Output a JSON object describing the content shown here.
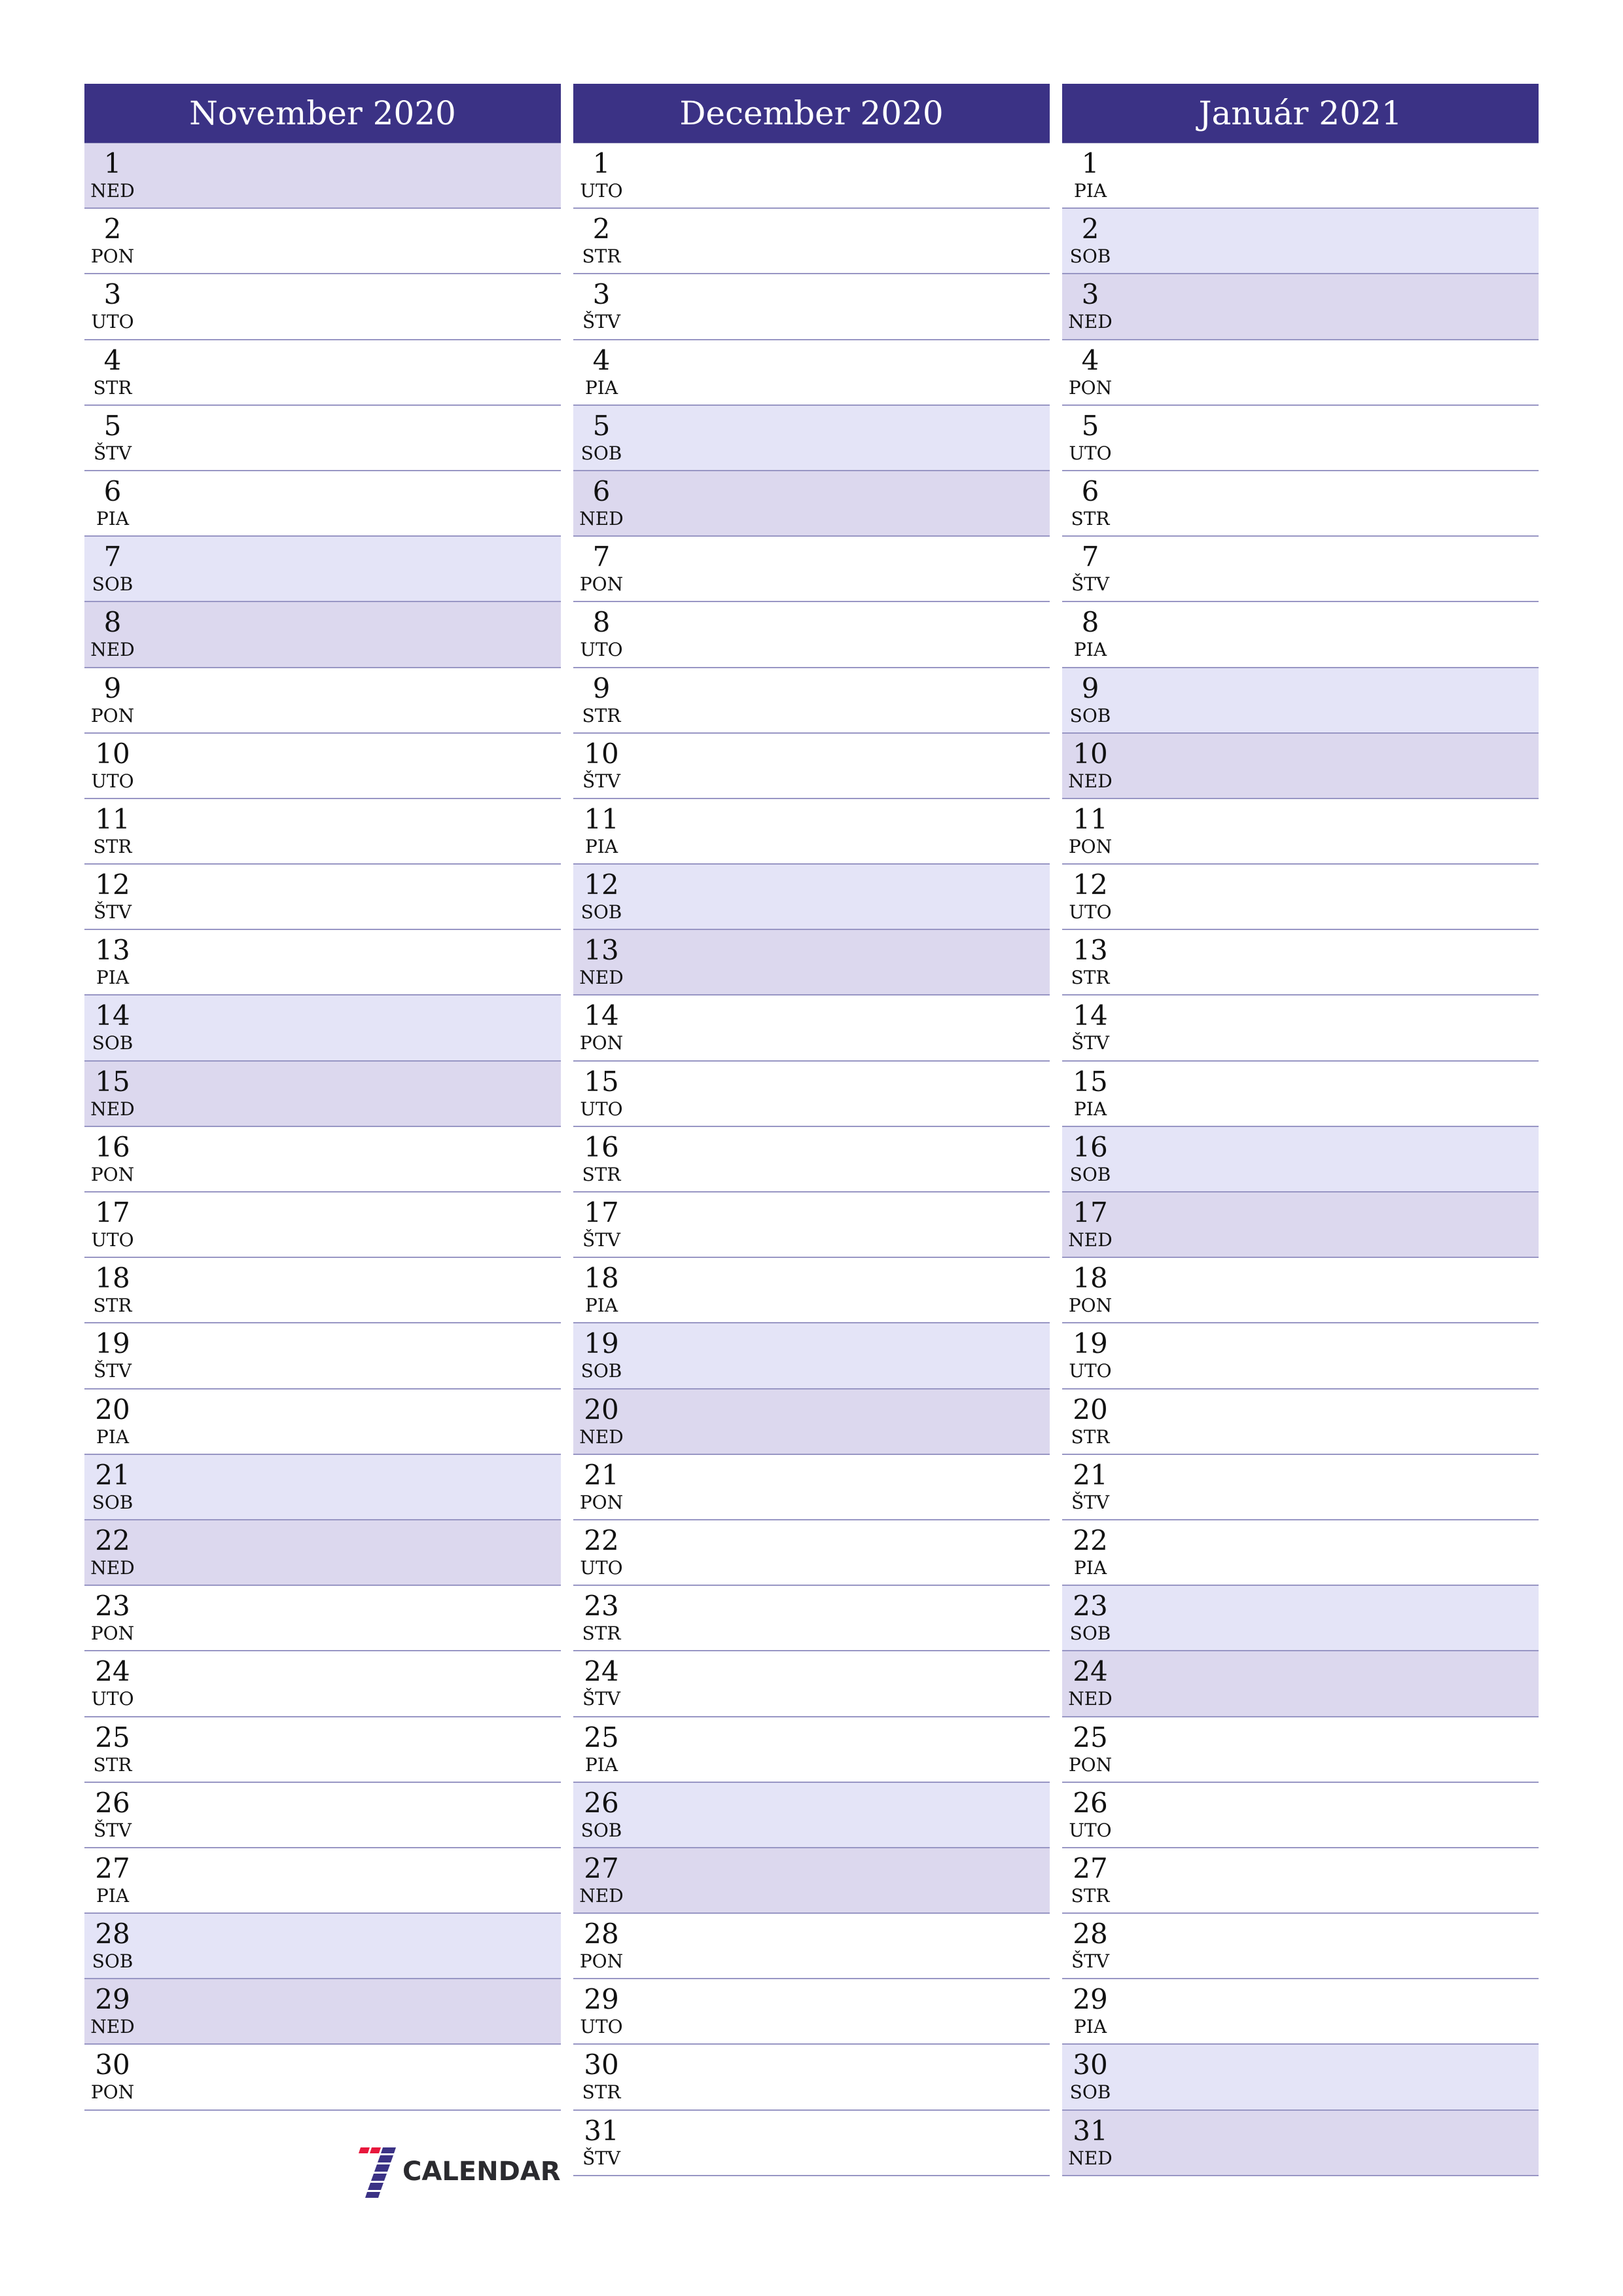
{
  "colors": {
    "header_bg": "#3b3285",
    "header_text": "#ffffff",
    "saturday_bg": "#e4e4f7",
    "sunday_bg": "#dcd8ee",
    "row_line": "#9896c4",
    "logo_red": "#e8173c",
    "logo_blue": "#3b3285"
  },
  "months": [
    {
      "title": "November 2020",
      "days": [
        {
          "n": "1",
          "d": "NED"
        },
        {
          "n": "2",
          "d": "PON"
        },
        {
          "n": "3",
          "d": "UTO"
        },
        {
          "n": "4",
          "d": "STR"
        },
        {
          "n": "5",
          "d": "ŠTV"
        },
        {
          "n": "6",
          "d": "PIA"
        },
        {
          "n": "7",
          "d": "SOB"
        },
        {
          "n": "8",
          "d": "NED"
        },
        {
          "n": "9",
          "d": "PON"
        },
        {
          "n": "10",
          "d": "UTO"
        },
        {
          "n": "11",
          "d": "STR"
        },
        {
          "n": "12",
          "d": "ŠTV"
        },
        {
          "n": "13",
          "d": "PIA"
        },
        {
          "n": "14",
          "d": "SOB"
        },
        {
          "n": "15",
          "d": "NED"
        },
        {
          "n": "16",
          "d": "PON"
        },
        {
          "n": "17",
          "d": "UTO"
        },
        {
          "n": "18",
          "d": "STR"
        },
        {
          "n": "19",
          "d": "ŠTV"
        },
        {
          "n": "20",
          "d": "PIA"
        },
        {
          "n": "21",
          "d": "SOB"
        },
        {
          "n": "22",
          "d": "NED"
        },
        {
          "n": "23",
          "d": "PON"
        },
        {
          "n": "24",
          "d": "UTO"
        },
        {
          "n": "25",
          "d": "STR"
        },
        {
          "n": "26",
          "d": "ŠTV"
        },
        {
          "n": "27",
          "d": "PIA"
        },
        {
          "n": "28",
          "d": "SOB"
        },
        {
          "n": "29",
          "d": "NED"
        },
        {
          "n": "30",
          "d": "PON"
        }
      ]
    },
    {
      "title": "December 2020",
      "days": [
        {
          "n": "1",
          "d": "UTO"
        },
        {
          "n": "2",
          "d": "STR"
        },
        {
          "n": "3",
          "d": "ŠTV"
        },
        {
          "n": "4",
          "d": "PIA"
        },
        {
          "n": "5",
          "d": "SOB"
        },
        {
          "n": "6",
          "d": "NED"
        },
        {
          "n": "7",
          "d": "PON"
        },
        {
          "n": "8",
          "d": "UTO"
        },
        {
          "n": "9",
          "d": "STR"
        },
        {
          "n": "10",
          "d": "ŠTV"
        },
        {
          "n": "11",
          "d": "PIA"
        },
        {
          "n": "12",
          "d": "SOB"
        },
        {
          "n": "13",
          "d": "NED"
        },
        {
          "n": "14",
          "d": "PON"
        },
        {
          "n": "15",
          "d": "UTO"
        },
        {
          "n": "16",
          "d": "STR"
        },
        {
          "n": "17",
          "d": "ŠTV"
        },
        {
          "n": "18",
          "d": "PIA"
        },
        {
          "n": "19",
          "d": "SOB"
        },
        {
          "n": "20",
          "d": "NED"
        },
        {
          "n": "21",
          "d": "PON"
        },
        {
          "n": "22",
          "d": "UTO"
        },
        {
          "n": "23",
          "d": "STR"
        },
        {
          "n": "24",
          "d": "ŠTV"
        },
        {
          "n": "25",
          "d": "PIA"
        },
        {
          "n": "26",
          "d": "SOB"
        },
        {
          "n": "27",
          "d": "NED"
        },
        {
          "n": "28",
          "d": "PON"
        },
        {
          "n": "29",
          "d": "UTO"
        },
        {
          "n": "30",
          "d": "STR"
        },
        {
          "n": "31",
          "d": "ŠTV"
        }
      ]
    },
    {
      "title": "Január 2021",
      "days": [
        {
          "n": "1",
          "d": "PIA"
        },
        {
          "n": "2",
          "d": "SOB"
        },
        {
          "n": "3",
          "d": "NED"
        },
        {
          "n": "4",
          "d": "PON"
        },
        {
          "n": "5",
          "d": "UTO"
        },
        {
          "n": "6",
          "d": "STR"
        },
        {
          "n": "7",
          "d": "ŠTV"
        },
        {
          "n": "8",
          "d": "PIA"
        },
        {
          "n": "9",
          "d": "SOB"
        },
        {
          "n": "10",
          "d": "NED"
        },
        {
          "n": "11",
          "d": "PON"
        },
        {
          "n": "12",
          "d": "UTO"
        },
        {
          "n": "13",
          "d": "STR"
        },
        {
          "n": "14",
          "d": "ŠTV"
        },
        {
          "n": "15",
          "d": "PIA"
        },
        {
          "n": "16",
          "d": "SOB"
        },
        {
          "n": "17",
          "d": "NED"
        },
        {
          "n": "18",
          "d": "PON"
        },
        {
          "n": "19",
          "d": "UTO"
        },
        {
          "n": "20",
          "d": "STR"
        },
        {
          "n": "21",
          "d": "ŠTV"
        },
        {
          "n": "22",
          "d": "PIA"
        },
        {
          "n": "23",
          "d": "SOB"
        },
        {
          "n": "24",
          "d": "NED"
        },
        {
          "n": "25",
          "d": "PON"
        },
        {
          "n": "26",
          "d": "UTO"
        },
        {
          "n": "27",
          "d": "STR"
        },
        {
          "n": "28",
          "d": "ŠTV"
        },
        {
          "n": "29",
          "d": "PIA"
        },
        {
          "n": "30",
          "d": "SOB"
        },
        {
          "n": "31",
          "d": "NED"
        }
      ]
    }
  ],
  "weekend_labels": {
    "saturday": "SOB",
    "sunday": "NED"
  },
  "logo": {
    "text": "CALENDAR",
    "icon": "seven-logo-icon"
  }
}
